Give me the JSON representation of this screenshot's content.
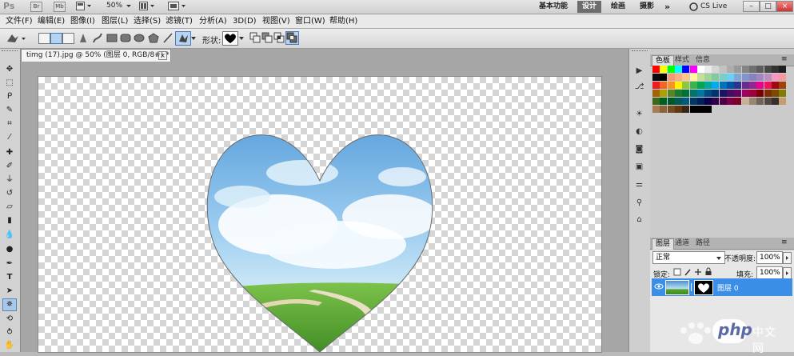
{
  "app": {
    "logo": "Ps",
    "bridge": "Br",
    "minibridge": "Mb",
    "zoom": "50%",
    "workspaces": [
      "基本功能",
      "设计",
      "绘画",
      "摄影"
    ],
    "workspace_active": "设计",
    "more": "»",
    "cslive": "CS Live",
    "window_buttons": [
      "–",
      "□",
      "×"
    ]
  },
  "menubar": [
    "文件(F)",
    "编辑(E)",
    "图像(I)",
    "图层(L)",
    "选择(S)",
    "滤镜(T)",
    "分析(A)",
    "3D(D)",
    "视图(V)",
    "窗口(W)",
    "帮助(H)"
  ],
  "options": {
    "shape_label": "形状:",
    "shape_value": "heart"
  },
  "document": {
    "tab_title": "timg (17).jpg @ 50% (图层 0, RGB/8#) *",
    "tab_close": "×"
  },
  "tools": [
    "move-tool",
    "marquee-tool",
    "lasso-tool",
    "quick-select-tool",
    "crop-tool",
    "eyedropper-tool",
    "healing-tool",
    "brush-tool",
    "stamp-tool",
    "history-brush-tool",
    "eraser-tool",
    "gradient-tool",
    "blur-tool",
    "dodge-tool",
    "pen-tool",
    "type-tool",
    "path-select-tool",
    "custom-shape-tool",
    "3d-rotate-tool",
    "3d-orbit-tool",
    "hand-tool"
  ],
  "color_panel": {
    "tabs": [
      "色板",
      "样式",
      "信息"
    ],
    "active_tab": "色板",
    "swatch_rows": [
      [
        "#ff0000",
        "#ffff00",
        "#00ff00",
        "#00ffff",
        "#0000ff",
        "#ff00ff",
        "#ffffff",
        "#ebebeb",
        "#d6d6d6",
        "#c2c2c2",
        "#adadad",
        "#999999",
        "#858585",
        "#707070",
        "#5c5c5c",
        "#474747",
        "#333333",
        "#1f1f1f"
      ],
      [
        "#0a0a0a",
        "#000000",
        "#f7977a",
        "#f9ad81",
        "#fdc68a",
        "#fff79a",
        "#c4df9b",
        "#a2d39c",
        "#82ca9d",
        "#7bcdc8",
        "#6ecff6",
        "#7ea7d8",
        "#8493ca",
        "#8882be",
        "#a187be",
        "#bc8dbf",
        "#f49ac2",
        "#f6989d"
      ],
      [
        "#ed1c24",
        "#f26522",
        "#f7941d",
        "#fff200",
        "#8dc63f",
        "#39b54a",
        "#00a651",
        "#00a99d",
        "#00aeef",
        "#0072bc",
        "#0054a6",
        "#2e3192",
        "#662d91",
        "#92278f",
        "#ec008c",
        "#ed145b",
        "#9e0b0f",
        "#a0410d"
      ],
      [
        "#a36209",
        "#aba000",
        "#598527",
        "#1a7b30",
        "#007236",
        "#00746b",
        "#0076a3",
        "#004b80",
        "#003471",
        "#1b1464",
        "#440e62",
        "#630460",
        "#9e005d",
        "#9e0039",
        "#790000",
        "#7b2e00",
        "#7d4900",
        "#827b00"
      ],
      [
        "#406618",
        "#005e20",
        "#005826",
        "#005952",
        "#005b7f",
        "#003663",
        "#002157",
        "#0d004c",
        "#32004b",
        "#4b0049",
        "#7b0046",
        "#7a0026",
        "#c7b299",
        "#998675",
        "#736357",
        "#534741",
        "#362f2d",
        "#c69c6d"
      ],
      [
        "#a67c52",
        "#8c6239",
        "#754c24",
        "#603913",
        "#3c2415",
        "#000000",
        "#000000",
        "#000000"
      ]
    ]
  },
  "layers_panel": {
    "tabs": [
      "图层",
      "通道",
      "路径"
    ],
    "active_tab": "图层",
    "blend_mode": "正常",
    "opacity_label": "不透明度:",
    "opacity_value": "100%",
    "lock_label": "锁定:",
    "fill_label": "填充:",
    "fill_value": "100%",
    "layer_name": "图层 0"
  },
  "watermark": "php",
  "colors": {
    "accent": "#3a8ee6",
    "sky_top": "#5fa3dd",
    "grass": "#5aa631"
  }
}
